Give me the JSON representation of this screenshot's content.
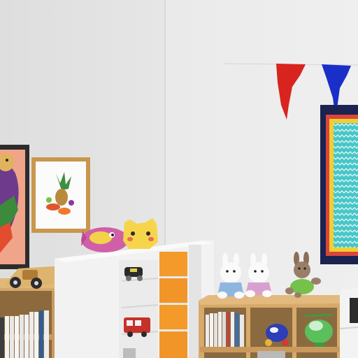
{
  "scene": {
    "kind": "3d-rendered-room-corner",
    "objects": [
      "left-wall",
      "right-wall",
      "bunting-flag-red",
      "bunting-flag-blue",
      "patterned-wall-hanging",
      "bird-painting",
      "pineapple-still-life-painting",
      "pink-fish-plush",
      "yellow-cat-plush",
      "wooden-toy-car",
      "white-drawer-cabinet",
      "orange-drawers",
      "small-black-toy-car",
      "red-toy-bus",
      "left-wooden-bookshelf",
      "right-wooden-cube-shelf",
      "white-bunny-plush-blue",
      "white-bunny-plush-pink",
      "brown-bunny-plush",
      "green-toy-helicopter",
      "blue-toy-ball-car",
      "white-side-cabinet"
    ]
  },
  "colors": {
    "wall_left": "#e4e4e4",
    "wall_right": "#ececec",
    "flag_red": "#d8241f",
    "flag_blue": "#1a2fc8",
    "wood": "#d7a96a",
    "drawer_orange": "#f39a2a",
    "cabinet_white": "#f2f2f2",
    "frame_navy": "#1b2350",
    "turquoise": "#48c6c8"
  }
}
